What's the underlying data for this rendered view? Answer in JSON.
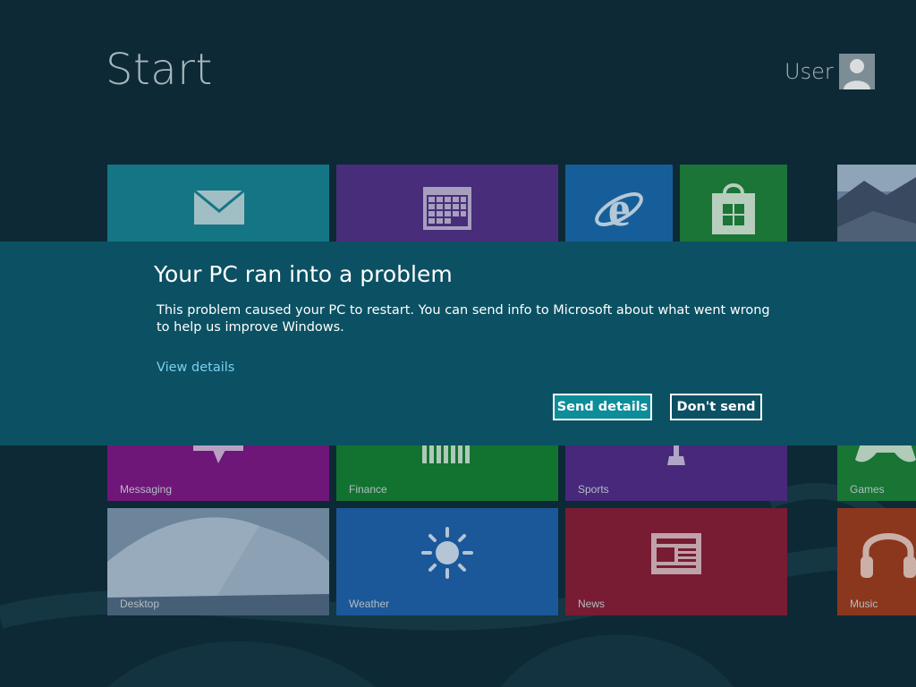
{
  "header": {
    "title": "Start",
    "user_name": "User",
    "avatar_icon": "person-silhouette-icon"
  },
  "tiles": [
    {
      "id": "mail",
      "label": "",
      "color": "#16808f",
      "icon": "envelope-icon"
    },
    {
      "id": "calendar",
      "label": "",
      "color": "#502f84",
      "icon": "calendar-icon"
    },
    {
      "id": "ie",
      "label": "",
      "color": "#1866a6",
      "icon": "internet-explorer-icon"
    },
    {
      "id": "store",
      "label": "",
      "color": "#1c7f38",
      "icon": "store-bag-icon"
    },
    {
      "id": "photos",
      "label": "",
      "color": "#51637a",
      "icon": "landscape-photo"
    },
    {
      "id": "messaging",
      "label": "Messaging",
      "color": "#7b1683",
      "icon": "speech-bubble-icon"
    },
    {
      "id": "finance",
      "label": "Finance",
      "color": "#137d33",
      "icon": "bar-chart-icon"
    },
    {
      "id": "sports",
      "label": "Sports",
      "color": "#4f2a85",
      "icon": "trophy-icon"
    },
    {
      "id": "games",
      "label": "Games",
      "color": "#1a7f36",
      "icon": "game-controller-icon"
    },
    {
      "id": "desktop",
      "label": "Desktop",
      "color": "#5c7a96",
      "icon": "desktop-wallpaper"
    },
    {
      "id": "weather",
      "label": "Weather",
      "color": "#1e5fa6",
      "icon": "sun-icon"
    },
    {
      "id": "news",
      "label": "News",
      "color": "#841c35",
      "icon": "newspaper-icon"
    },
    {
      "id": "music",
      "label": "Music",
      "color": "#9a3a1c",
      "icon": "headphones-icon"
    }
  ],
  "dialog": {
    "title": "Your PC ran into a problem",
    "body": "This problem caused your PC to restart. You can send info to Microsoft about what went wrong to help us improve Windows.",
    "link": "View details",
    "send_button": "Send details",
    "dont_send_button": "Don't send",
    "background_color": "#0b5163",
    "accent_color": "#0d8d9a",
    "link_color": "#7ad0ef"
  }
}
